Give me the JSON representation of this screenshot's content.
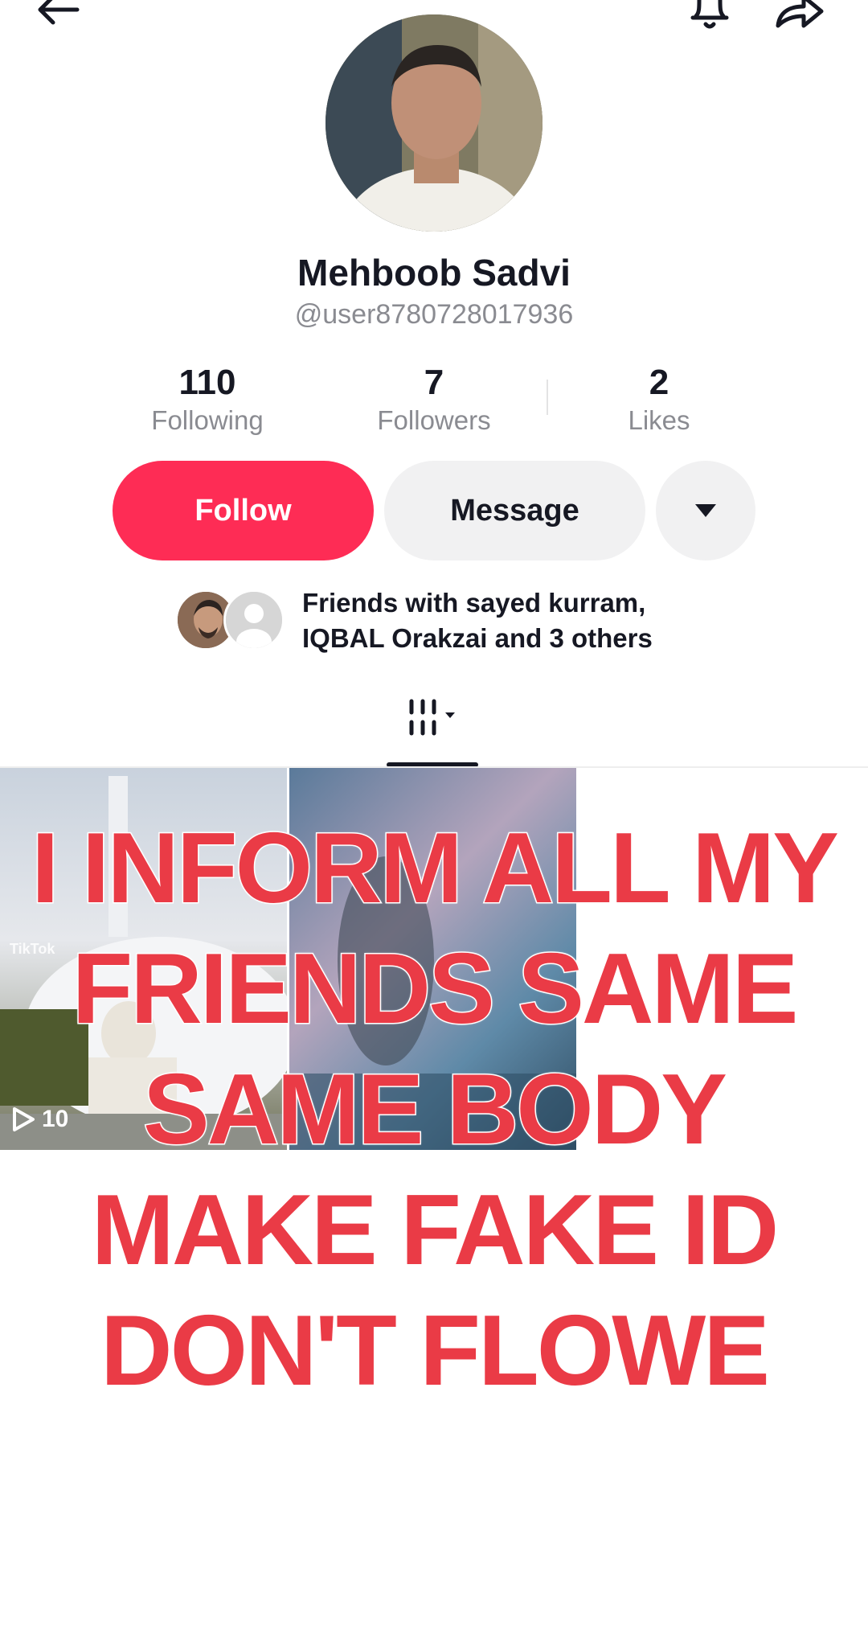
{
  "profile": {
    "name": "Mehboob Sadvi",
    "handle": "@user8780728017936"
  },
  "stats": [
    {
      "value": "110",
      "label": "Following"
    },
    {
      "value": "7",
      "label": "Followers"
    },
    {
      "value": "2",
      "label": "Likes"
    }
  ],
  "actions": {
    "follow_label": "Follow",
    "message_label": "Message"
  },
  "friends": {
    "text_line1": "Friends with sayed kurram,",
    "text_line2": "IQBAL Orakzai and 3 others"
  },
  "videos": [
    {
      "play_count": "10",
      "watermark": "TikTok"
    },
    {
      "play_count": ""
    }
  ],
  "overlay": {
    "lines": [
      "I INFORM ALL MY",
      "FRIENDS SAME",
      "SAME BODY",
      "MAKE FAKE ID",
      "DON'T FLOWE"
    ]
  },
  "colors": {
    "accent": "#fe2c55",
    "overlay_text": "#ea3b46"
  },
  "icons": [
    "back-arrow-icon",
    "bell-icon",
    "share-icon",
    "chevron-down-icon",
    "grid-view-icon",
    "play-icon"
  ]
}
